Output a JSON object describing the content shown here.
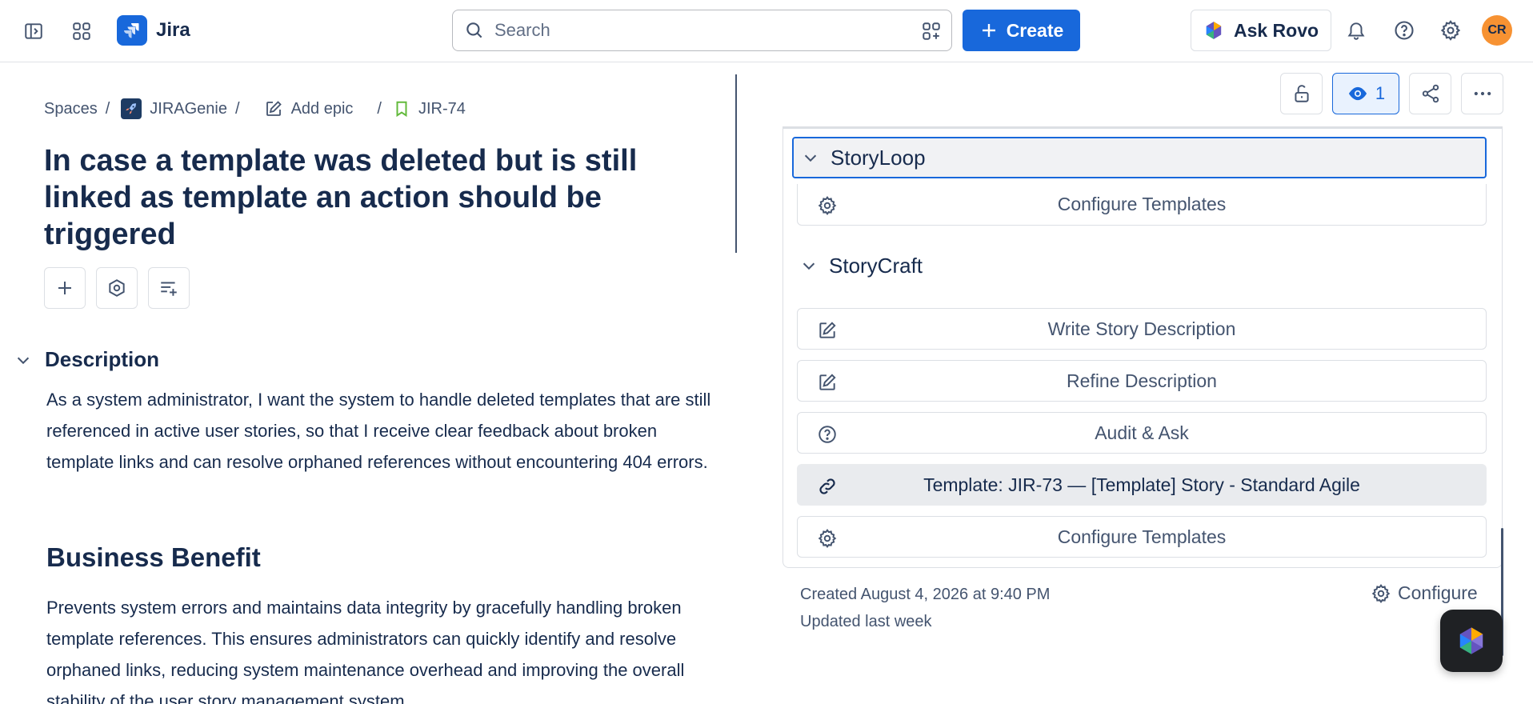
{
  "app": {
    "name": "Jira"
  },
  "search": {
    "placeholder": "Search"
  },
  "create_label": "Create",
  "rovo_label": "Ask Rovo",
  "avatar_initials": "CR",
  "breadcrumb": {
    "spaces": "Spaces",
    "project": "JIRAGenie",
    "epic": "Add epic",
    "issue_key": "JIR-74",
    "separator": "/"
  },
  "issue": {
    "title": "In case a template was deleted but is still linked as template an action should be triggered"
  },
  "description": {
    "heading": "Description",
    "text": "As a system administrator, I want the system to handle deleted templates that are still referenced in active user stories, so that I receive clear feedback about broken template links and can resolve orphaned references without encountering 404 errors.",
    "benefit_heading": "Business Benefit",
    "benefit_text": "Prevents system errors and maintains data integrity by gracefully handling broken template references. This ensures administrators can quickly identify and resolve orphaned links, reducing system maintenance overhead and improving the overall stability of the user story management system."
  },
  "watch_count": "1",
  "panel": {
    "storyloop": {
      "title": "StoryLoop",
      "configure": "Configure Templates"
    },
    "storycraft": {
      "title": "StoryCraft",
      "write": "Write Story Description",
      "refine": "Refine Description",
      "audit": "Audit & Ask",
      "template": "Template: JIR-73 — [Template] Story - Standard Agile",
      "configure": "Configure Templates"
    }
  },
  "meta": {
    "created": "Created August 4, 2026 at 9:40 PM",
    "updated": "Updated last week",
    "configure": "Configure"
  },
  "colors": {
    "brand_blue": "#1868db",
    "text": "#172b4d",
    "subtle_text": "#44546f",
    "avatar": "#f79232"
  }
}
